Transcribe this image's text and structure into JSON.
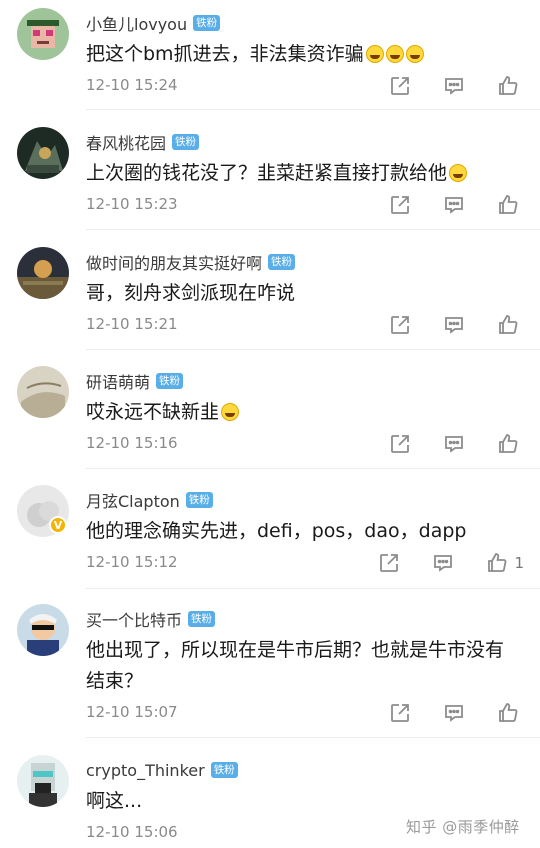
{
  "comments": [
    {
      "user": "小鱼儿lovyou",
      "badge": "铁粉",
      "text": "把这个bm抓进去，非法集资诈骗",
      "emoji_count": 3,
      "time": "12-10 15:24",
      "likes": ""
    },
    {
      "user": "春风桃花园",
      "badge": "铁粉",
      "text": "上次圈的钱花没了？韭菜赶紧直接打款给他",
      "emoji_count": 1,
      "time": "12-10 15:23",
      "likes": ""
    },
    {
      "user": "做时间的朋友其实挺好啊",
      "badge": "铁粉",
      "text": "哥，刻舟求剑派现在咋说",
      "emoji_count": 0,
      "time": "12-10 15:21",
      "likes": ""
    },
    {
      "user": "研语萌萌",
      "badge": "铁粉",
      "text": "哎永远不缺新韭",
      "emoji_count": 1,
      "time": "12-10 15:16",
      "likes": ""
    },
    {
      "user": "月弦Clapton",
      "badge": "铁粉",
      "text": "他的理念确实先进，defi，pos，dao，dapp",
      "emoji_count": 0,
      "time": "12-10 15:12",
      "likes": "1",
      "verified": "V"
    },
    {
      "user": "买一个比特币",
      "badge": "铁粉",
      "text": "他出现了，所以现在是牛市后期？也就是牛市没有结束？",
      "emoji_count": 0,
      "time": "12-10 15:07",
      "likes": ""
    },
    {
      "user": "crypto_Thinker",
      "badge": "铁粉",
      "text": "啊这...",
      "emoji_count": 0,
      "time": "12-10 15:06",
      "likes": ""
    }
  ],
  "watermark": "知乎 @雨季仲醉",
  "icons": {
    "share": "share-icon",
    "reply": "reply-icon",
    "like": "like-icon"
  },
  "colors": {
    "badge": "#5aaee8",
    "time": "#8a8a8a",
    "icon": "#8c8c8c",
    "verified": "#f4b400"
  }
}
